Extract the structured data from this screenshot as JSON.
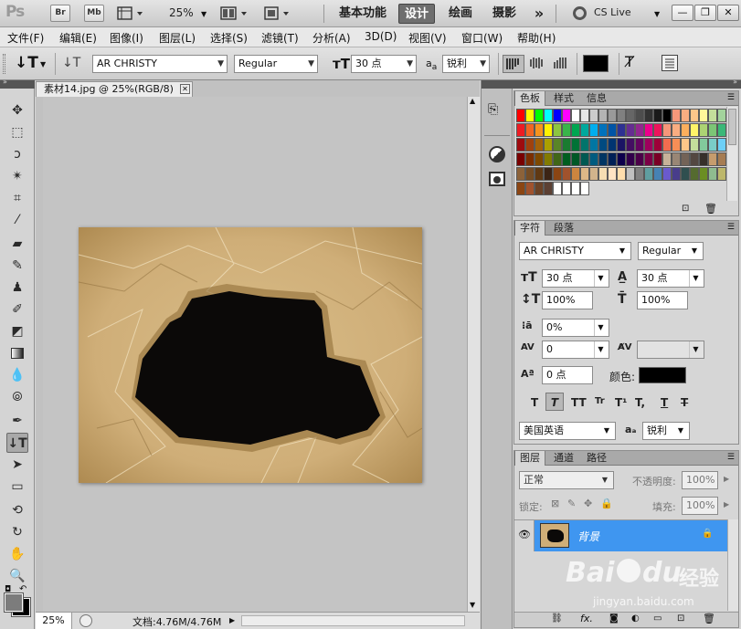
{
  "titlebar": {
    "logo": "Ps",
    "bridge": "Br",
    "minibridge": "Mb",
    "zoom": "25%",
    "workspaces": [
      "基本功能",
      "设计",
      "绘画",
      "摄影"
    ],
    "more": "»",
    "cslive": "CS Live"
  },
  "menu": [
    "文件(F)",
    "编辑(E)",
    "图像(I)",
    "图层(L)",
    "选择(S)",
    "滤镜(T)",
    "分析(A)",
    "3D(D)",
    "视图(V)",
    "窗口(W)",
    "帮助(H)"
  ],
  "options": {
    "font_family": "AR CHRISTY",
    "font_style": "Regular",
    "font_size": "30 点",
    "aa_label": "a",
    "antialias": "锐利",
    "color": "#000000"
  },
  "document": {
    "tab_title": "素材14.jpg @ 25%(RGB/8)",
    "zoom": "25%",
    "doc_info": "文档:4.76M/4.76M"
  },
  "swatch_panel": {
    "tabs": [
      "色板",
      "样式",
      "信息"
    ]
  },
  "character_panel": {
    "tabs": [
      "字符",
      "段落"
    ],
    "font_family": "AR CHRISTY",
    "font_style": "Regular",
    "font_size": "30 点",
    "leading": "30 点",
    "vertical_scale": "100%",
    "horizontal_scale": "100%",
    "tsume": "0%",
    "kerning": "0",
    "baseline_shift": "0 点",
    "color_label": "颜色:",
    "language": "美国英语",
    "antialias": "锐利",
    "style_buttons": [
      "T",
      "T",
      "TT",
      "Tr",
      "T¹",
      "T,",
      "T",
      "T"
    ]
  },
  "layers_panel": {
    "tabs": [
      "图层",
      "通道",
      "路径"
    ],
    "blend_mode": "正常",
    "opacity_label": "不透明度:",
    "opacity": "100%",
    "lock_label": "锁定:",
    "fill_label": "填充:",
    "fill": "100%",
    "layer_name": "背景"
  },
  "watermark": {
    "brand": "Bai",
    "brand2": "du",
    "brand3": "经验",
    "url": "jingyan.baidu.com"
  },
  "colors": {
    "accent": "#3d8fe0",
    "selected_layer": "#3f96f0",
    "paper": "#cfae78"
  }
}
